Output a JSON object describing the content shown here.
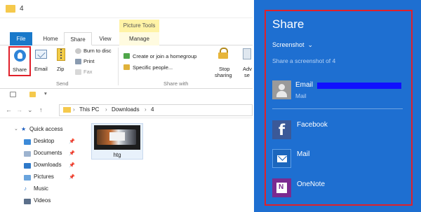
{
  "window": {
    "title": "4"
  },
  "ribbon": {
    "tabs": [
      {
        "label": "File"
      },
      {
        "label": "Home"
      },
      {
        "label": "Share"
      },
      {
        "label": "View"
      },
      {
        "label": "Manage"
      }
    ],
    "contextual_group": "Picture Tools",
    "send_group": {
      "label": "Send",
      "share": "Share",
      "email": "Email",
      "zip": "Zip",
      "burn": "Burn to disc",
      "print": "Print",
      "fax": "Fax"
    },
    "share_with_group": {
      "label": "Share with",
      "homegroup": "Create or join a homegroup",
      "specific_people": "Specific people...",
      "stop_sharing_line1": "Stop",
      "stop_sharing_line2": "sharing",
      "advanced_line1": "Adv",
      "advanced_line2": "se"
    }
  },
  "address_bar": {
    "crumbs": [
      "This PC",
      "Downloads",
      "4"
    ]
  },
  "nav_pane": {
    "items": [
      {
        "label": "Quick access"
      },
      {
        "label": "Desktop"
      },
      {
        "label": "Documents"
      },
      {
        "label": "Downloads"
      },
      {
        "label": "Pictures"
      },
      {
        "label": "Music"
      },
      {
        "label": "Videos"
      }
    ]
  },
  "files": [
    {
      "name": "htg"
    }
  ],
  "share_charm": {
    "title": "Share",
    "selector": "Screenshot",
    "subtitle": "Share a screenshot of 4",
    "email": {
      "name": "Email",
      "sub": "Mail"
    },
    "apps": [
      {
        "label": "Facebook"
      },
      {
        "label": "Mail"
      },
      {
        "label": "OneNote"
      }
    ]
  },
  "colors": {
    "share_panel_bg": "#1e6fd1",
    "highlight_border": "#e0202a",
    "file_tab": "#1979ca",
    "picture_tools": "#fff3a6",
    "facebook": "#3b5998",
    "onenote": "#7b2a90"
  }
}
